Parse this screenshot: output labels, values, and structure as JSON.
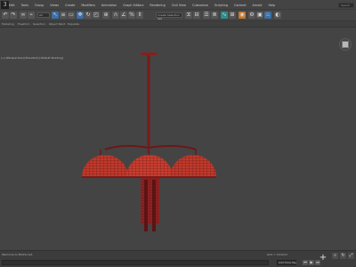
{
  "menubar": {
    "logo": "3",
    "items": [
      "Edit",
      "Tools",
      "Group",
      "Views",
      "Create",
      "Modifiers",
      "Animation",
      "Graph Editors",
      "Rendering",
      "Civil View",
      "Customize",
      "Scripting",
      "Content",
      "Arnold",
      "Help"
    ],
    "search_placeholder": "Search"
  },
  "toolbar": {
    "selection_filter": "All",
    "named_selection": "Create Selection Set"
  },
  "ribbon": {
    "items": [
      "Modeling",
      "Freeform",
      "Selection",
      "Object Paint",
      "Populate"
    ]
  },
  "viewport": {
    "label": "[+] [Perspective] [Standard] [Default Shading]"
  },
  "status": {
    "left": "Welcome to MAXScript.",
    "coords": "Grid = 10,0mm",
    "add_time_tag": "Add Time Tag"
  },
  "colors": {
    "background": "#444444",
    "wireframe": "#c0392b",
    "toolbar_blue": "#3d6fa3"
  },
  "icons": {
    "play": "play-icon",
    "zoom": "zoom-icon",
    "pan": "pan-icon",
    "orbit": "orbit-icon",
    "maximize": "maximize-icon"
  }
}
